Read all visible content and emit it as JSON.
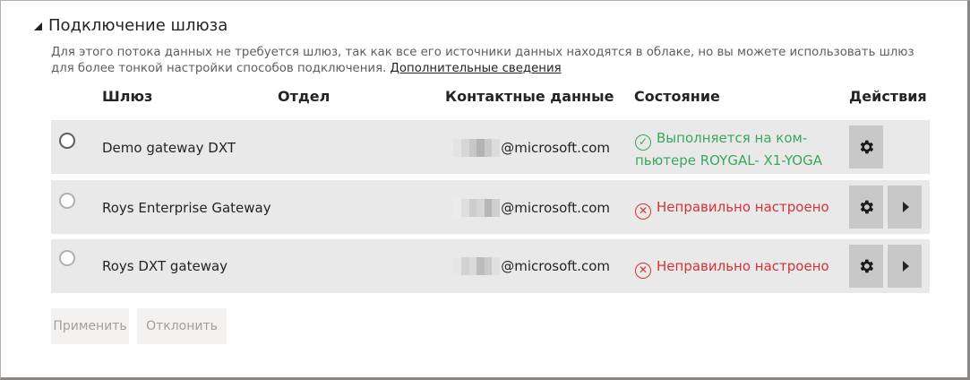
{
  "section": {
    "title": "Подключение шлюза",
    "description": "Для этого потока данных не требуется шлюз, так как все его источники данных находятся в облаке, но вы можете использовать шлюз для более тонкой настройки способов подключения.",
    "more_link": "Дополнительные сведения"
  },
  "columns": {
    "gateway": "Шлюз",
    "department": "Отдел",
    "contact": "Контактные данные",
    "status": "Состояние",
    "actions": "Действия"
  },
  "rows": [
    {
      "name": "Demo gateway DXT",
      "contact": "@microsoft.com",
      "status_line1": "Выполняется на ком-",
      "status_line2": "пьютере ROYGAL- X1-YOGA",
      "status_type": "ok"
    },
    {
      "name": "Roys Enterprise Gateway",
      "contact": "@microsoft.com",
      "status_line1": "Неправильно настроено",
      "status_type": "err"
    },
    {
      "name": "Roys DXT gateway",
      "contact": "@microsoft.com",
      "status_line1": "Неправильно настроено",
      "status_type": "err"
    }
  ],
  "footer": {
    "apply": "Применить",
    "discard": "Отклонить"
  },
  "colors": {
    "ok": "#3aa85b",
    "err": "#d13438",
    "row_bg": "#e9e9e9"
  }
}
